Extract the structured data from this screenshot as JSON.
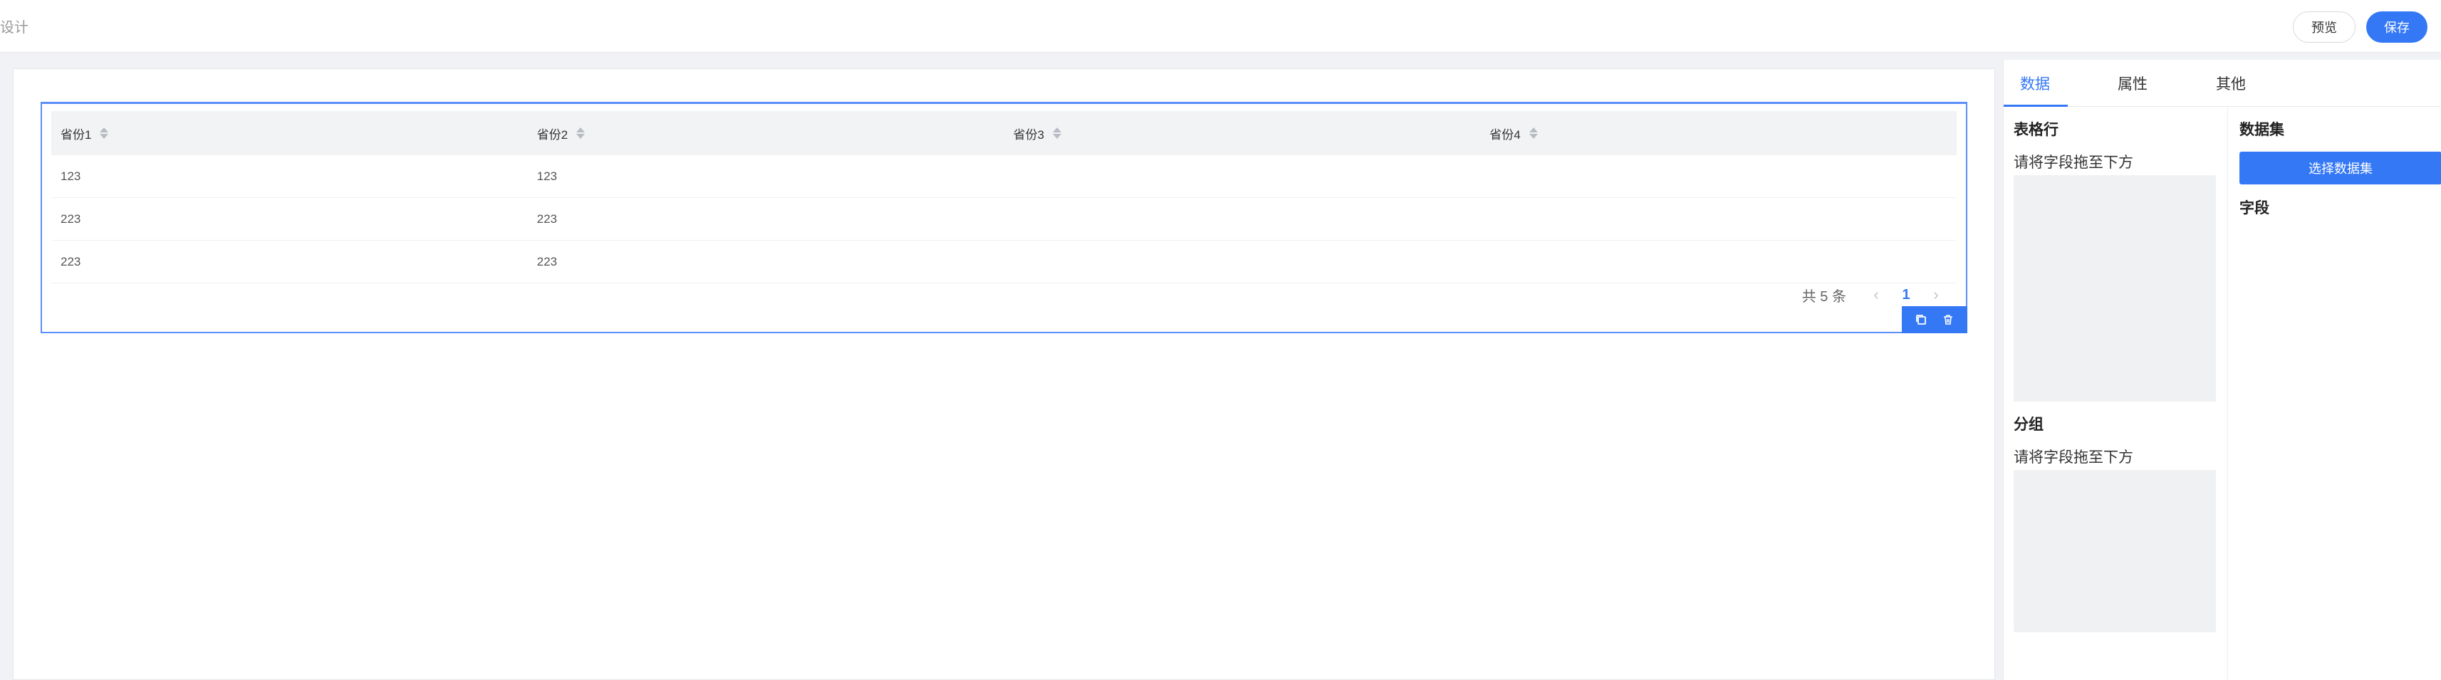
{
  "header": {
    "title": "设计",
    "preview_label": "预览",
    "save_label": "保存"
  },
  "table": {
    "columns": [
      "省份1",
      "省份2",
      "省份3",
      "省份4"
    ],
    "rows": [
      [
        "123",
        "123",
        "",
        ""
      ],
      [
        "223",
        "223",
        "",
        ""
      ],
      [
        "223",
        "223",
        "",
        ""
      ]
    ]
  },
  "pagination": {
    "total_text": "共 5 条",
    "current_page": "1"
  },
  "panel": {
    "tabs": [
      "数据",
      "属性",
      "其他"
    ],
    "active_tab": "数据",
    "table_rows_title": "表格行",
    "table_rows_hint": "请将字段拖至下方",
    "group_title": "分组",
    "group_hint": "请将字段拖至下方",
    "dataset_title": "数据集",
    "select_dataset_label": "选择数据集",
    "fields_title": "字段"
  },
  "colors": {
    "accent": "#3478f6",
    "selection_border": "#5b8ff9",
    "dropzone_bg": "#f0f1f3"
  }
}
